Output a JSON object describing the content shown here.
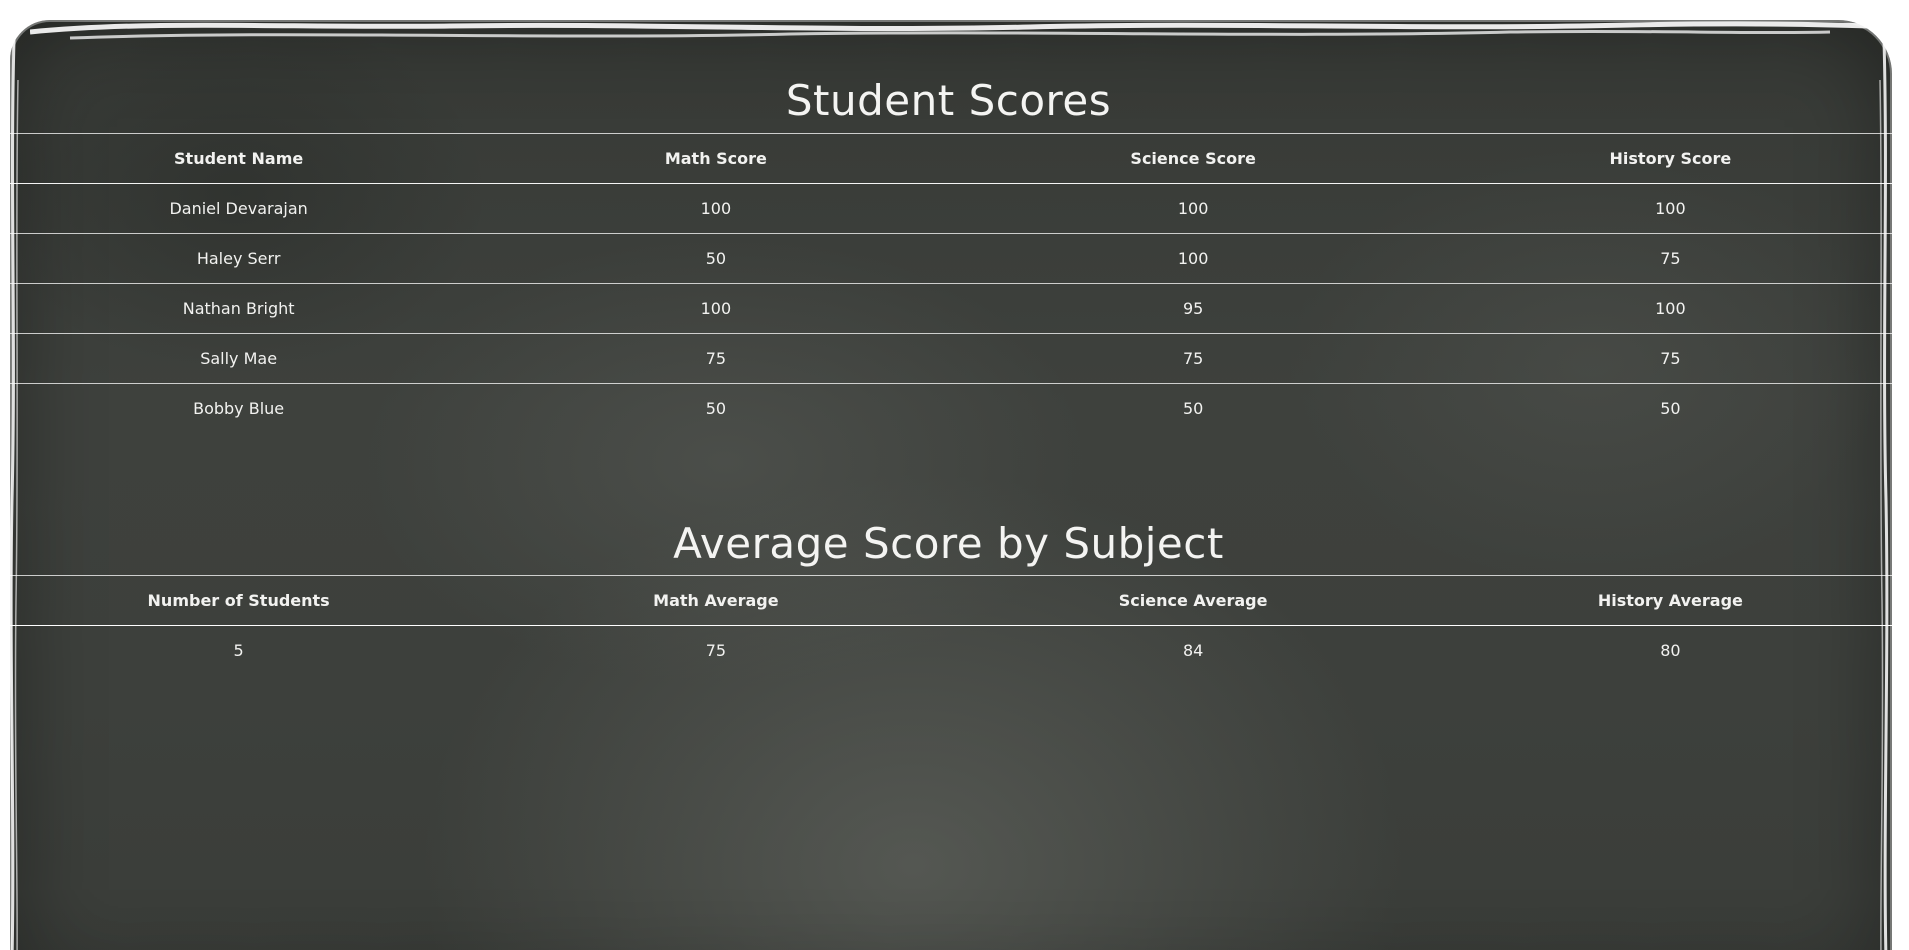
{
  "student_scores": {
    "title": "Student Scores",
    "headers": [
      "Student Name",
      "Math Score",
      "Science Score",
      "History Score"
    ],
    "rows": [
      [
        "Daniel Devarajan",
        "100",
        "100",
        "100"
      ],
      [
        "Haley Serr",
        "50",
        "100",
        "75"
      ],
      [
        "Nathan Bright",
        "100",
        "95",
        "100"
      ],
      [
        "Sally Mae",
        "75",
        "75",
        "75"
      ],
      [
        "Bobby Blue",
        "50",
        "50",
        "50"
      ]
    ]
  },
  "average_scores": {
    "title": "Average Score by Subject",
    "headers": [
      "Number of Students",
      "Math Average",
      "Science Average",
      "History Average"
    ],
    "rows": [
      [
        "5",
        "75",
        "84",
        "80"
      ]
    ]
  },
  "colors": {
    "board": "#3b3e3a",
    "chalk_text": "#f2f2f0",
    "page_background": "#ffffff"
  }
}
